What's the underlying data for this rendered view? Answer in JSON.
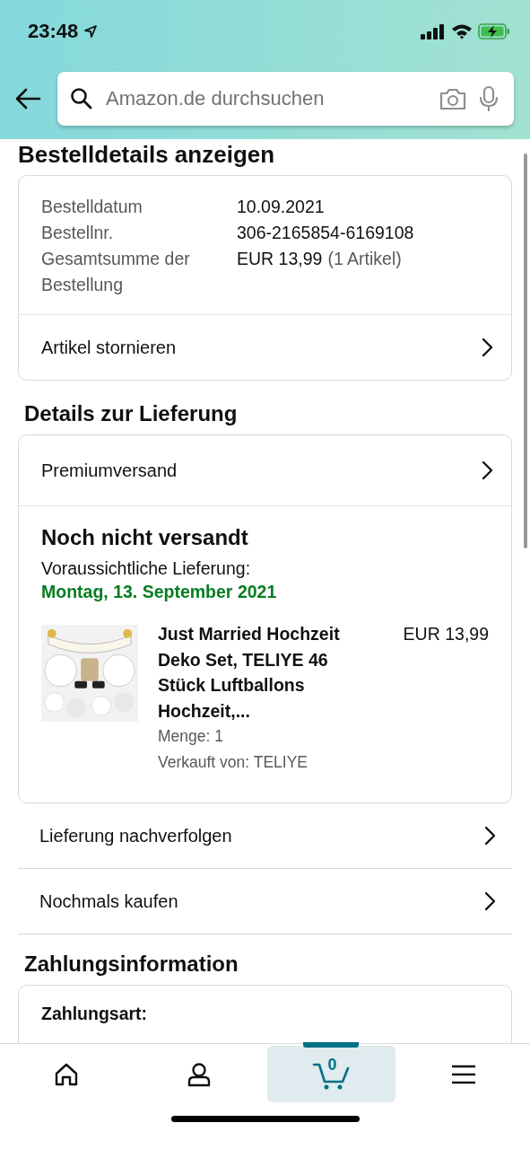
{
  "status_bar": {
    "time": "23:48"
  },
  "search": {
    "placeholder": "Amazon.de durchsuchen"
  },
  "page_title": "Bestelldetails anzeigen",
  "order_summary": {
    "fields": [
      {
        "label": "Bestelldatum",
        "value": "10.09.2021"
      },
      {
        "label": "Bestellnr.",
        "value": "306-2165854-6169108"
      },
      {
        "label": "Gesamtsumme der Bestellung",
        "value": "EUR 13,99",
        "note": "(1 Artikel)"
      }
    ],
    "action": "Artikel stornieren"
  },
  "delivery": {
    "heading": "Details zur Lieferung",
    "shipping_method": "Premiumversand",
    "status": "Noch nicht versandt",
    "expected_label": "Voraussichtliche Lieferung:",
    "expected_date": "Montag, 13. September 2021",
    "items": [
      {
        "title": "Just Married Hochzeit Deko Set, TELIYE 46 Stück Luftballons Hochzeit,...",
        "price": "EUR 13,99",
        "quantity": "Menge: 1",
        "seller": "Verkauft von: TELIYE"
      }
    ]
  },
  "actions": [
    "Lieferung nachverfolgen",
    "Nochmals kaufen"
  ],
  "payment": {
    "heading": "Zahlungsinformation",
    "method_label": "Zahlungsart:"
  },
  "bottom_nav": [
    {
      "kind": "home",
      "selected": false
    },
    {
      "kind": "account",
      "selected": false
    },
    {
      "kind": "cart",
      "selected": true,
      "count": "0"
    },
    {
      "kind": "menu",
      "selected": false
    }
  ]
}
